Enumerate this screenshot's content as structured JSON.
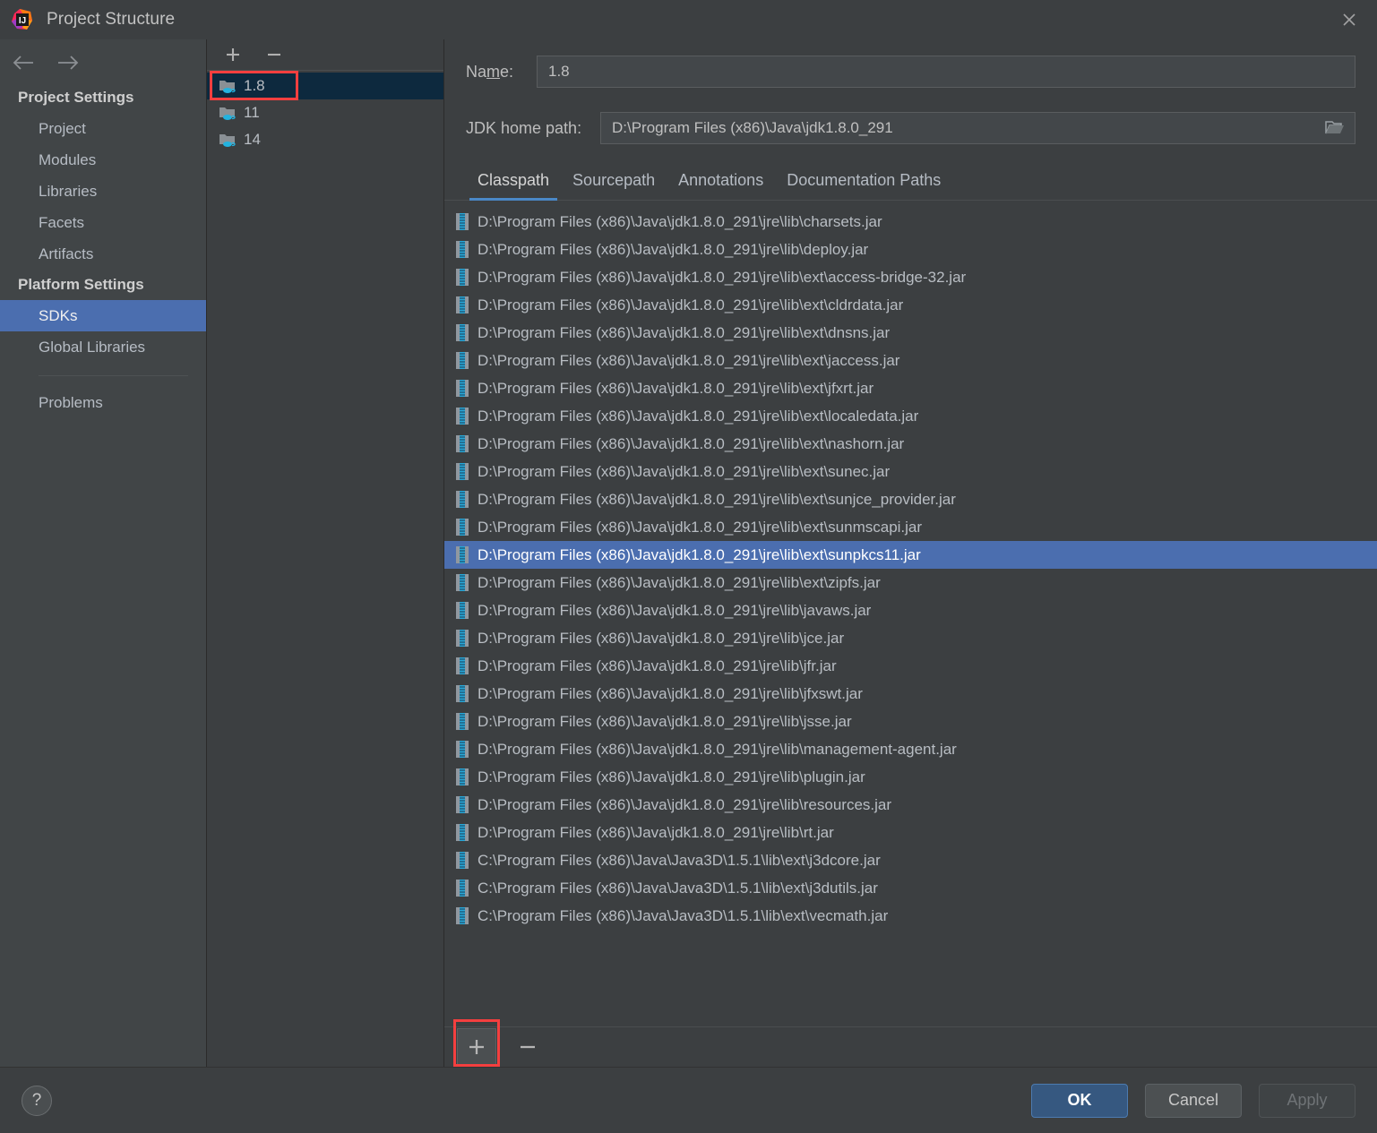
{
  "window": {
    "title": "Project Structure",
    "logo_icon": "intellij-idea-logo",
    "close_icon": "close-icon"
  },
  "nav": {
    "back_icon": "arrow-left-icon",
    "forward_icon": "arrow-right-icon"
  },
  "sidebar": {
    "groups": [
      {
        "label": "Project Settings",
        "items": [
          {
            "label": "Project",
            "selected": false
          },
          {
            "label": "Modules",
            "selected": false
          },
          {
            "label": "Libraries",
            "selected": false
          },
          {
            "label": "Facets",
            "selected": false
          },
          {
            "label": "Artifacts",
            "selected": false
          }
        ]
      },
      {
        "label": "Platform Settings",
        "items": [
          {
            "label": "SDKs",
            "selected": true
          },
          {
            "label": "Global Libraries",
            "selected": false
          }
        ]
      }
    ],
    "extra_items": [
      {
        "label": "Problems",
        "selected": false
      }
    ]
  },
  "sdk_list": {
    "toolbar": {
      "add_label": "+",
      "remove_label": "−"
    },
    "items": [
      {
        "label": "1.8",
        "selected": true,
        "icon": "jdk-folder-icon"
      },
      {
        "label": "11",
        "selected": false,
        "icon": "jdk-folder-icon"
      },
      {
        "label": "14",
        "selected": false,
        "icon": "jdk-folder-icon"
      }
    ]
  },
  "detail": {
    "name_label_pre": "Na",
    "name_label_mn": "m",
    "name_label_post": "e:",
    "name_value": "1.8",
    "home_label": "JDK home path:",
    "home_value": "D:\\Program Files (x86)\\Java\\jdk1.8.0_291",
    "browse_icon": "folder-open-icon",
    "tabs": [
      {
        "label": "Classpath",
        "active": true
      },
      {
        "label": "Sourcepath",
        "active": false
      },
      {
        "label": "Annotations",
        "active": false
      },
      {
        "label": "Documentation Paths",
        "active": false
      }
    ],
    "classpath": [
      {
        "path": "D:\\Program Files (x86)\\Java\\jdk1.8.0_291\\jre\\lib\\charsets.jar",
        "selected": false
      },
      {
        "path": "D:\\Program Files (x86)\\Java\\jdk1.8.0_291\\jre\\lib\\deploy.jar",
        "selected": false
      },
      {
        "path": "D:\\Program Files (x86)\\Java\\jdk1.8.0_291\\jre\\lib\\ext\\access-bridge-32.jar",
        "selected": false
      },
      {
        "path": "D:\\Program Files (x86)\\Java\\jdk1.8.0_291\\jre\\lib\\ext\\cldrdata.jar",
        "selected": false
      },
      {
        "path": "D:\\Program Files (x86)\\Java\\jdk1.8.0_291\\jre\\lib\\ext\\dnsns.jar",
        "selected": false
      },
      {
        "path": "D:\\Program Files (x86)\\Java\\jdk1.8.0_291\\jre\\lib\\ext\\jaccess.jar",
        "selected": false
      },
      {
        "path": "D:\\Program Files (x86)\\Java\\jdk1.8.0_291\\jre\\lib\\ext\\jfxrt.jar",
        "selected": false
      },
      {
        "path": "D:\\Program Files (x86)\\Java\\jdk1.8.0_291\\jre\\lib\\ext\\localedata.jar",
        "selected": false
      },
      {
        "path": "D:\\Program Files (x86)\\Java\\jdk1.8.0_291\\jre\\lib\\ext\\nashorn.jar",
        "selected": false
      },
      {
        "path": "D:\\Program Files (x86)\\Java\\jdk1.8.0_291\\jre\\lib\\ext\\sunec.jar",
        "selected": false
      },
      {
        "path": "D:\\Program Files (x86)\\Java\\jdk1.8.0_291\\jre\\lib\\ext\\sunjce_provider.jar",
        "selected": false
      },
      {
        "path": "D:\\Program Files (x86)\\Java\\jdk1.8.0_291\\jre\\lib\\ext\\sunmscapi.jar",
        "selected": false
      },
      {
        "path": "D:\\Program Files (x86)\\Java\\jdk1.8.0_291\\jre\\lib\\ext\\sunpkcs11.jar",
        "selected": true
      },
      {
        "path": "D:\\Program Files (x86)\\Java\\jdk1.8.0_291\\jre\\lib\\ext\\zipfs.jar",
        "selected": false
      },
      {
        "path": "D:\\Program Files (x86)\\Java\\jdk1.8.0_291\\jre\\lib\\javaws.jar",
        "selected": false
      },
      {
        "path": "D:\\Program Files (x86)\\Java\\jdk1.8.0_291\\jre\\lib\\jce.jar",
        "selected": false
      },
      {
        "path": "D:\\Program Files (x86)\\Java\\jdk1.8.0_291\\jre\\lib\\jfr.jar",
        "selected": false
      },
      {
        "path": "D:\\Program Files (x86)\\Java\\jdk1.8.0_291\\jre\\lib\\jfxswt.jar",
        "selected": false
      },
      {
        "path": "D:\\Program Files (x86)\\Java\\jdk1.8.0_291\\jre\\lib\\jsse.jar",
        "selected": false
      },
      {
        "path": "D:\\Program Files (x86)\\Java\\jdk1.8.0_291\\jre\\lib\\management-agent.jar",
        "selected": false
      },
      {
        "path": "D:\\Program Files (x86)\\Java\\jdk1.8.0_291\\jre\\lib\\plugin.jar",
        "selected": false
      },
      {
        "path": "D:\\Program Files (x86)\\Java\\jdk1.8.0_291\\jre\\lib\\resources.jar",
        "selected": false
      },
      {
        "path": "D:\\Program Files (x86)\\Java\\jdk1.8.0_291\\jre\\lib\\rt.jar",
        "selected": false
      },
      {
        "path": "C:\\Program Files (x86)\\Java\\Java3D\\1.5.1\\lib\\ext\\j3dcore.jar",
        "selected": false
      },
      {
        "path": "C:\\Program Files (x86)\\Java\\Java3D\\1.5.1\\lib\\ext\\j3dutils.jar",
        "selected": false
      },
      {
        "path": "C:\\Program Files (x86)\\Java\\Java3D\\1.5.1\\lib\\ext\\vecmath.jar",
        "selected": false
      }
    ],
    "classpath_toolbar": {
      "add_label": "+",
      "remove_label": "−"
    }
  },
  "footer": {
    "help_label": "?",
    "ok_label": "OK",
    "cancel_label": "Cancel",
    "apply_label": "Apply"
  },
  "annotations": {
    "highlight_color": "#f43f3f",
    "boxes": [
      "sdk-item-1.8",
      "classpath-add-button"
    ]
  },
  "colors": {
    "selection_blue": "#4b6eaf",
    "inactive_selection": "#0d293e",
    "tab_underline": "#4a88c7",
    "primary_button": "#365880",
    "background": "#3c3f41",
    "sidebar_background": "#414547"
  }
}
